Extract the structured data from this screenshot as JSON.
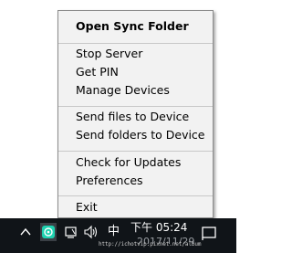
{
  "context_menu": {
    "items": [
      {
        "label": "Open Sync Folder",
        "bold": true
      },
      {
        "label": "Stop Server"
      },
      {
        "label": "Get PIN"
      },
      {
        "label": "Manage Devices"
      },
      {
        "label": "Send files to Device"
      },
      {
        "label": "Send folders to Device"
      },
      {
        "label": "Check for Updates"
      },
      {
        "label": "Preferences"
      },
      {
        "label": "Exit"
      }
    ]
  },
  "taskbar": {
    "tray_icons": [
      "chevron-up-icon",
      "sync-app-icon",
      "pen-input-icon",
      "network-icon",
      "volume-icon"
    ],
    "ime_label": "中",
    "clock_time": "下午 05:24",
    "clock_date_partial": "2017/11/29",
    "notification_icon": "action-center-icon",
    "accent_color": "#1fd2b0"
  },
  "watermark": {
    "text": "http://ichotvip.pixnet.net/album"
  }
}
